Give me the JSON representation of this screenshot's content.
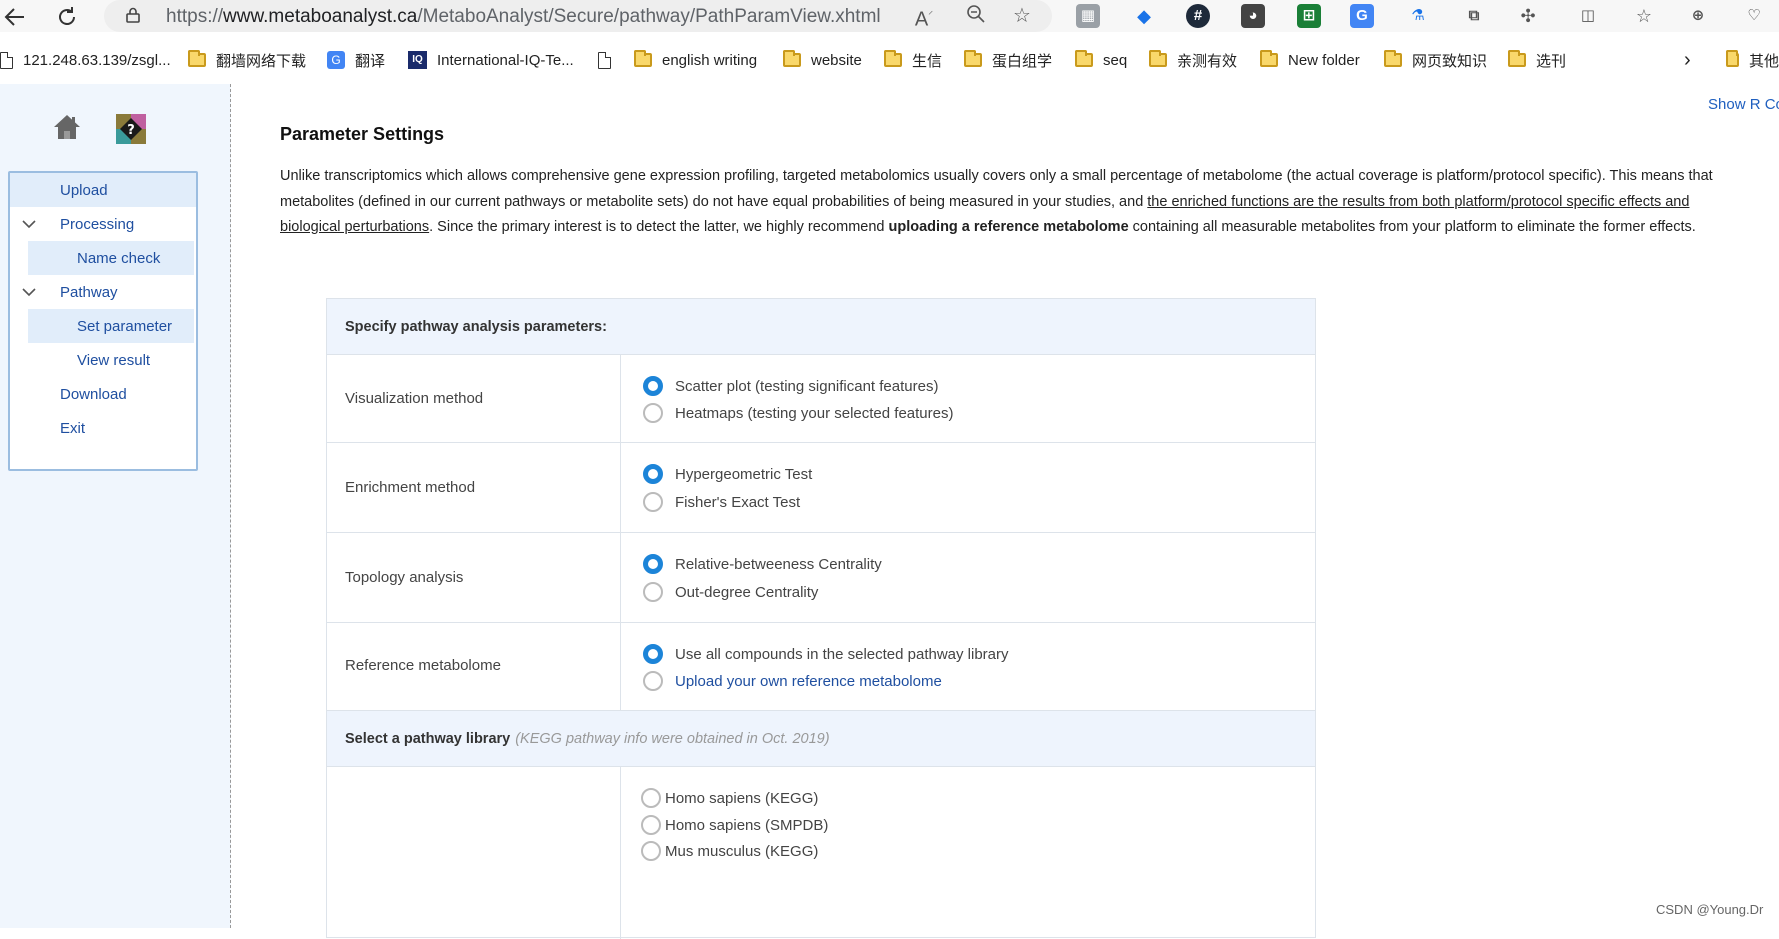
{
  "browser": {
    "url_prefix": "https://",
    "url_domain": "www.metaboanalyst.ca",
    "url_path": "/MetaboAnalyst/Secure/pathway/PathParamView.xhtml"
  },
  "bookmarks": [
    {
      "label": "121.248.63.139/zsgl...",
      "icon": "page-icon"
    },
    {
      "label": "翻墙网络下载",
      "icon": "folder-icon"
    },
    {
      "label": "翻译",
      "icon": "translate-icon"
    },
    {
      "label": "International-IQ-Te...",
      "icon": "iq-icon"
    },
    {
      "label": "english writing",
      "icon": "folder-icon"
    },
    {
      "label": "website",
      "icon": "folder-icon"
    },
    {
      "label": "生信",
      "icon": "folder-icon"
    },
    {
      "label": "蛋白组学",
      "icon": "folder-icon"
    },
    {
      "label": "seq",
      "icon": "folder-icon"
    },
    {
      "label": "亲测有效",
      "icon": "folder-icon"
    },
    {
      "label": "New folder",
      "icon": "folder-icon"
    },
    {
      "label": "网页致知识",
      "icon": "folder-icon"
    },
    {
      "label": "选刊",
      "icon": "folder-icon"
    },
    {
      "label": "其他",
      "icon": "folder-icon"
    }
  ],
  "sidebar": {
    "items": [
      {
        "label": "Upload"
      },
      {
        "label": "Processing"
      },
      {
        "label": "Name check"
      },
      {
        "label": "Pathway"
      },
      {
        "label": "Set parameter"
      },
      {
        "label": "View result"
      },
      {
        "label": "Download"
      },
      {
        "label": "Exit"
      }
    ]
  },
  "page": {
    "show_r": "Show R Co",
    "title": "Parameter Settings",
    "desc_part1": "Unlike transcriptomics which allows comprehensive gene expression profiling, targeted metabolomics usually covers only a small percentage of metabolome (the actual coverage is platform/protocol specific). This means that metabolites (defined in our current pathways or metabolite sets) do not have equal probabilities of being measured in your studies, and ",
    "desc_underline": "the enriched functions are the results from both platform/protocol specific effects and biological perturbations",
    "desc_part2": ". Since the primary interest is to detect the latter, we highly recommend ",
    "desc_bold": "uploading a reference metabolome",
    "desc_part3": " containing all measurable metabolites from your platform to eliminate the former effects."
  },
  "panel": {
    "header": "Specify pathway analysis parameters:",
    "rows": [
      {
        "label": "Visualization method",
        "options": [
          "Scatter plot (testing significant features)",
          "Heatmaps (testing your selected features)"
        ]
      },
      {
        "label": "Enrichment method",
        "options": [
          "Hypergeometric Test",
          "Fisher's Exact Test"
        ]
      },
      {
        "label": "Topology analysis",
        "options": [
          "Relative-betweeness Centrality",
          "Out-degree Centrality"
        ]
      },
      {
        "label": "Reference metabolome",
        "options": [
          "Use all compounds in the selected pathway library",
          "Upload your own reference metabolome"
        ]
      }
    ],
    "library_header": "Select a pathway library",
    "library_note": "(KEGG pathway info were obtained in Oct. 2019)",
    "libraries": [
      "Homo sapiens (KEGG)",
      "Homo sapiens (SMPDB)",
      "Mus musculus (KEGG)"
    ]
  },
  "watermark": "CSDN @Young.Dr",
  "colors": {
    "accent": "#1c84d8",
    "link": "#1f4fa0",
    "sidebar_bg": "#f0f6fd",
    "panel_header_bg": "#eef4fd"
  }
}
